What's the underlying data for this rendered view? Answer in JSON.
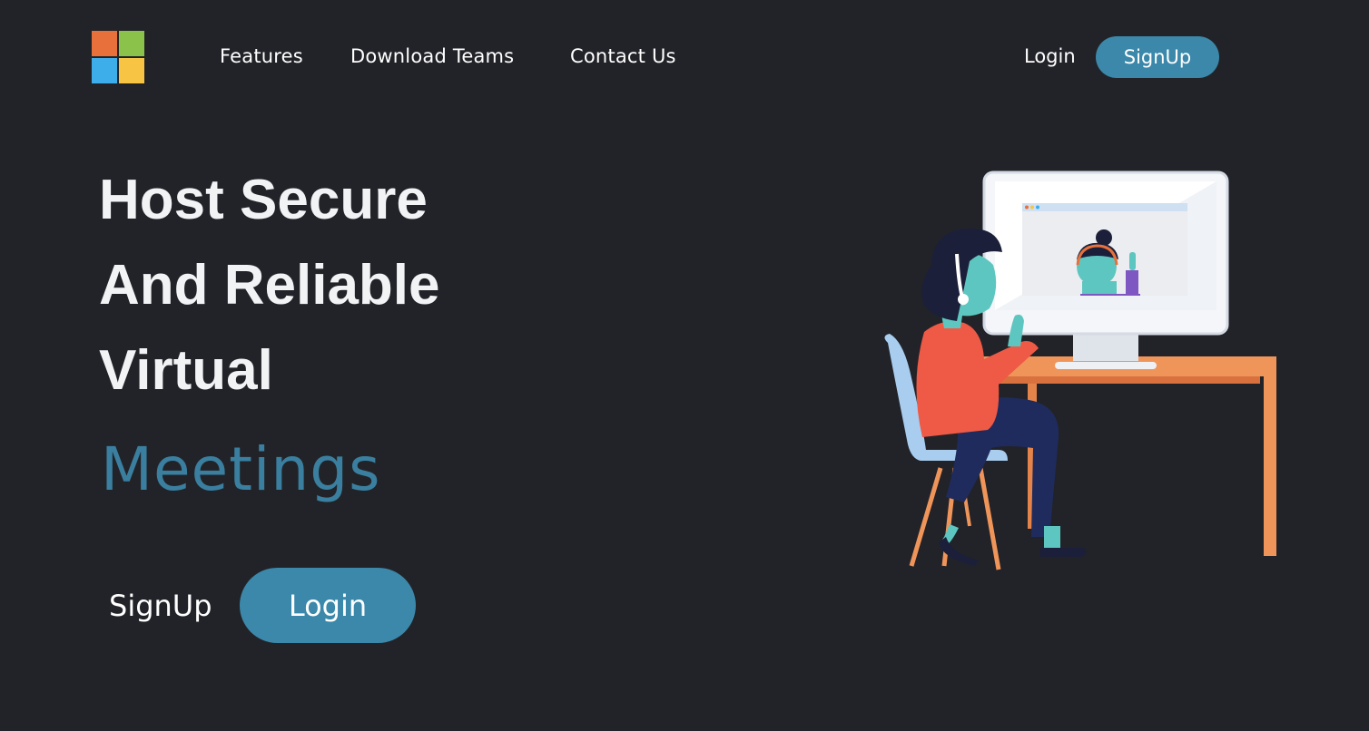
{
  "header": {
    "logo": {
      "icon": "windows-logo-icon",
      "colors": [
        "#e8703a",
        "#8bc34a",
        "#3daee9",
        "#f7c443"
      ]
    },
    "nav": [
      {
        "label": "Features"
      },
      {
        "label": "Download Teams"
      },
      {
        "label": "Contact Us"
      }
    ],
    "login_label": "Login",
    "signup_label": "SignUp"
  },
  "hero": {
    "lines": [
      "Host Secure",
      "And Reliable",
      "Virtual"
    ],
    "accent": "Meetings",
    "signup_label": "SignUp",
    "login_label": "Login"
  },
  "illustration": {
    "icon": "woman-at-computer-video-call-illustration"
  },
  "colors": {
    "background": "#222328",
    "accent": "#3b88aa",
    "accent_text": "#3a7f9f"
  }
}
